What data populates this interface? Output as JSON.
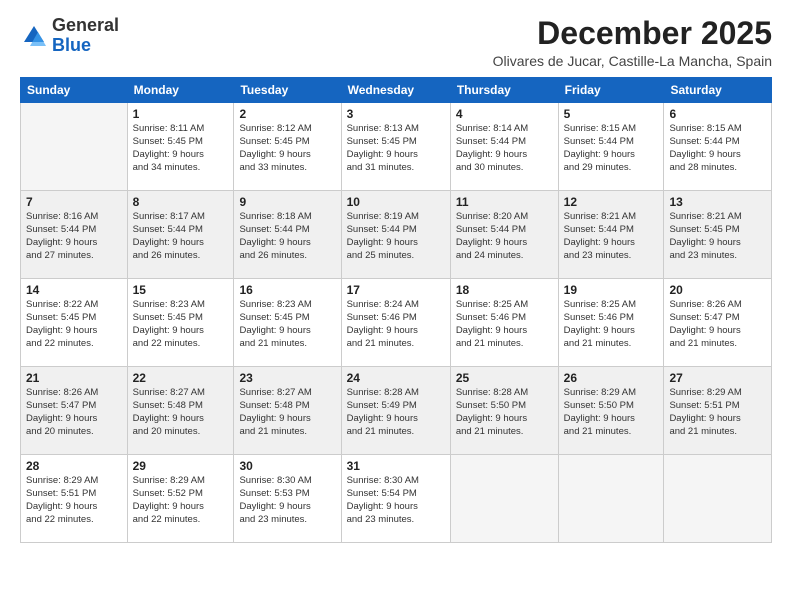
{
  "logo": {
    "general": "General",
    "blue": "Blue"
  },
  "header": {
    "month": "December 2025",
    "location": "Olivares de Jucar, Castille-La Mancha, Spain"
  },
  "days_of_week": [
    "Sunday",
    "Monday",
    "Tuesday",
    "Wednesday",
    "Thursday",
    "Friday",
    "Saturday"
  ],
  "weeks": [
    [
      {
        "day": "",
        "info": ""
      },
      {
        "day": "1",
        "info": "Sunrise: 8:11 AM\nSunset: 5:45 PM\nDaylight: 9 hours\nand 34 minutes."
      },
      {
        "day": "2",
        "info": "Sunrise: 8:12 AM\nSunset: 5:45 PM\nDaylight: 9 hours\nand 33 minutes."
      },
      {
        "day": "3",
        "info": "Sunrise: 8:13 AM\nSunset: 5:45 PM\nDaylight: 9 hours\nand 31 minutes."
      },
      {
        "day": "4",
        "info": "Sunrise: 8:14 AM\nSunset: 5:44 PM\nDaylight: 9 hours\nand 30 minutes."
      },
      {
        "day": "5",
        "info": "Sunrise: 8:15 AM\nSunset: 5:44 PM\nDaylight: 9 hours\nand 29 minutes."
      },
      {
        "day": "6",
        "info": "Sunrise: 8:15 AM\nSunset: 5:44 PM\nDaylight: 9 hours\nand 28 minutes."
      }
    ],
    [
      {
        "day": "7",
        "info": "Sunrise: 8:16 AM\nSunset: 5:44 PM\nDaylight: 9 hours\nand 27 minutes."
      },
      {
        "day": "8",
        "info": "Sunrise: 8:17 AM\nSunset: 5:44 PM\nDaylight: 9 hours\nand 26 minutes."
      },
      {
        "day": "9",
        "info": "Sunrise: 8:18 AM\nSunset: 5:44 PM\nDaylight: 9 hours\nand 26 minutes."
      },
      {
        "day": "10",
        "info": "Sunrise: 8:19 AM\nSunset: 5:44 PM\nDaylight: 9 hours\nand 25 minutes."
      },
      {
        "day": "11",
        "info": "Sunrise: 8:20 AM\nSunset: 5:44 PM\nDaylight: 9 hours\nand 24 minutes."
      },
      {
        "day": "12",
        "info": "Sunrise: 8:21 AM\nSunset: 5:44 PM\nDaylight: 9 hours\nand 23 minutes."
      },
      {
        "day": "13",
        "info": "Sunrise: 8:21 AM\nSunset: 5:45 PM\nDaylight: 9 hours\nand 23 minutes."
      }
    ],
    [
      {
        "day": "14",
        "info": "Sunrise: 8:22 AM\nSunset: 5:45 PM\nDaylight: 9 hours\nand 22 minutes."
      },
      {
        "day": "15",
        "info": "Sunrise: 8:23 AM\nSunset: 5:45 PM\nDaylight: 9 hours\nand 22 minutes."
      },
      {
        "day": "16",
        "info": "Sunrise: 8:23 AM\nSunset: 5:45 PM\nDaylight: 9 hours\nand 21 minutes."
      },
      {
        "day": "17",
        "info": "Sunrise: 8:24 AM\nSunset: 5:46 PM\nDaylight: 9 hours\nand 21 minutes."
      },
      {
        "day": "18",
        "info": "Sunrise: 8:25 AM\nSunset: 5:46 PM\nDaylight: 9 hours\nand 21 minutes."
      },
      {
        "day": "19",
        "info": "Sunrise: 8:25 AM\nSunset: 5:46 PM\nDaylight: 9 hours\nand 21 minutes."
      },
      {
        "day": "20",
        "info": "Sunrise: 8:26 AM\nSunset: 5:47 PM\nDaylight: 9 hours\nand 21 minutes."
      }
    ],
    [
      {
        "day": "21",
        "info": "Sunrise: 8:26 AM\nSunset: 5:47 PM\nDaylight: 9 hours\nand 20 minutes."
      },
      {
        "day": "22",
        "info": "Sunrise: 8:27 AM\nSunset: 5:48 PM\nDaylight: 9 hours\nand 20 minutes."
      },
      {
        "day": "23",
        "info": "Sunrise: 8:27 AM\nSunset: 5:48 PM\nDaylight: 9 hours\nand 21 minutes."
      },
      {
        "day": "24",
        "info": "Sunrise: 8:28 AM\nSunset: 5:49 PM\nDaylight: 9 hours\nand 21 minutes."
      },
      {
        "day": "25",
        "info": "Sunrise: 8:28 AM\nSunset: 5:50 PM\nDaylight: 9 hours\nand 21 minutes."
      },
      {
        "day": "26",
        "info": "Sunrise: 8:29 AM\nSunset: 5:50 PM\nDaylight: 9 hours\nand 21 minutes."
      },
      {
        "day": "27",
        "info": "Sunrise: 8:29 AM\nSunset: 5:51 PM\nDaylight: 9 hours\nand 21 minutes."
      }
    ],
    [
      {
        "day": "28",
        "info": "Sunrise: 8:29 AM\nSunset: 5:51 PM\nDaylight: 9 hours\nand 22 minutes."
      },
      {
        "day": "29",
        "info": "Sunrise: 8:29 AM\nSunset: 5:52 PM\nDaylight: 9 hours\nand 22 minutes."
      },
      {
        "day": "30",
        "info": "Sunrise: 8:30 AM\nSunset: 5:53 PM\nDaylight: 9 hours\nand 23 minutes."
      },
      {
        "day": "31",
        "info": "Sunrise: 8:30 AM\nSunset: 5:54 PM\nDaylight: 9 hours\nand 23 minutes."
      },
      {
        "day": "",
        "info": ""
      },
      {
        "day": "",
        "info": ""
      },
      {
        "day": "",
        "info": ""
      }
    ]
  ]
}
